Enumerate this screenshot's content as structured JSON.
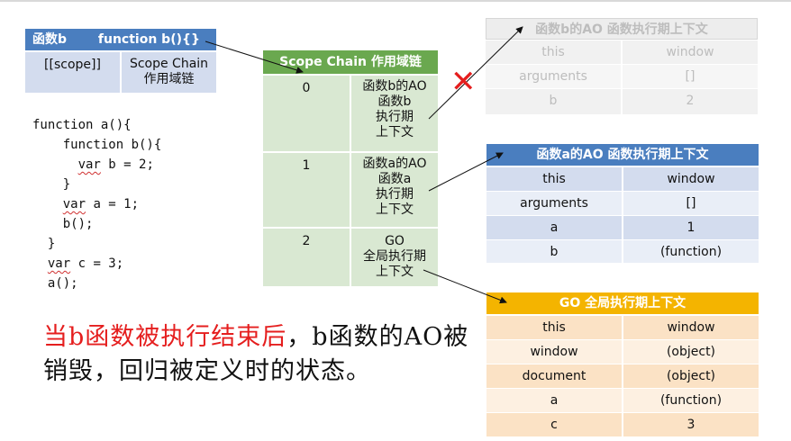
{
  "func_b_box": {
    "name": "函数b",
    "signature": "function b(){}",
    "scope_label": "[[scope]]",
    "scope_chain_label": "Scope Chain\n作用域链"
  },
  "code_lines": [
    "function a(){",
    "    function b(){",
    "      var b = 2;",
    "    }",
    "    var a = 1;",
    "    b();",
    "  }",
    "  var c = 3;",
    "  a();"
  ],
  "scope_chain": {
    "title": "Scope Chain 作用域链",
    "rows": [
      {
        "index": "0",
        "desc": "函数b的AO\n函数b\n执行期\n上下文"
      },
      {
        "index": "1",
        "desc": "函数a的AO\n函数a\n执行期\n上下文"
      },
      {
        "index": "2",
        "desc": "GO\n全局执行期\n上下文"
      }
    ]
  },
  "ao_b": {
    "title": "函数b的AO 函数执行期上下文",
    "rows": [
      [
        "this",
        "window"
      ],
      [
        "arguments",
        "[]"
      ],
      [
        "b",
        "2"
      ]
    ]
  },
  "ao_a": {
    "title": "函数a的AO 函数执行期上下文",
    "rows": [
      [
        "this",
        "window"
      ],
      [
        "arguments",
        "[]"
      ],
      [
        "a",
        "1"
      ],
      [
        "b",
        "(function)"
      ]
    ]
  },
  "go": {
    "title": "GO 全局执行期上下文",
    "rows": [
      [
        "this",
        "window"
      ],
      [
        "window",
        "(object)"
      ],
      [
        "document",
        "(object)"
      ],
      [
        "a",
        "(function)"
      ],
      [
        "c",
        "3"
      ]
    ]
  },
  "caption": {
    "red": "当b函数被执行结束后",
    "rest": "，b函数的AO被销毁，回归被定义时的状态。"
  },
  "cross_mark": "✕",
  "colors": {
    "blue_header": "#4a7ebf",
    "blue_cell": "#d3dcee",
    "green_header": "#6aa84f",
    "green_cell": "#d9e8d2",
    "orange_header": "#f4b400",
    "orange_cell": "#fbe2c5",
    "destroyed_gray": "#bdbdbd",
    "red": "#e51e1e"
  }
}
